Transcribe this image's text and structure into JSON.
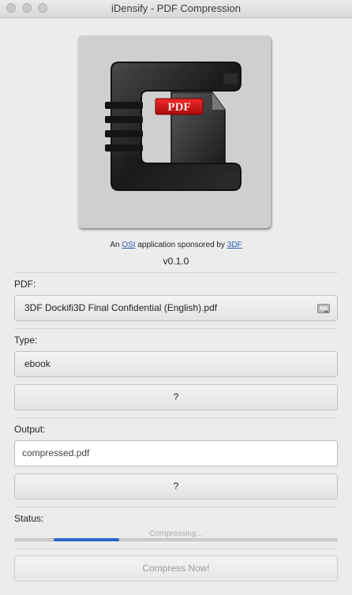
{
  "window": {
    "title": "iDensify - PDF Compression"
  },
  "logo": {
    "icon": "pdf-compress-clamp-icon",
    "pdf_text": "PDF"
  },
  "credit": {
    "prefix": "An",
    "osi_link": "OSI",
    "middle": "application sponsored by",
    "sponsor_link": "3DF"
  },
  "version": "v0.1.0",
  "pdf": {
    "label": "PDF:",
    "file": "3DF Dockifi3D Final Confidential (English).pdf",
    "browse_icon": "folder-icon"
  },
  "type": {
    "label": "Type:",
    "value": "ebook",
    "help_label": "?"
  },
  "output": {
    "label": "Output:",
    "value": "compressed.pdf",
    "help_label": "?"
  },
  "status": {
    "label": "Status:",
    "text": "Compressing...",
    "progress_fraction": 0.2
  },
  "compress_button": "Compress Now!",
  "colors": {
    "accent": "#2a68c9",
    "link": "#2a5db0",
    "pdf_red": "#d8161b"
  }
}
